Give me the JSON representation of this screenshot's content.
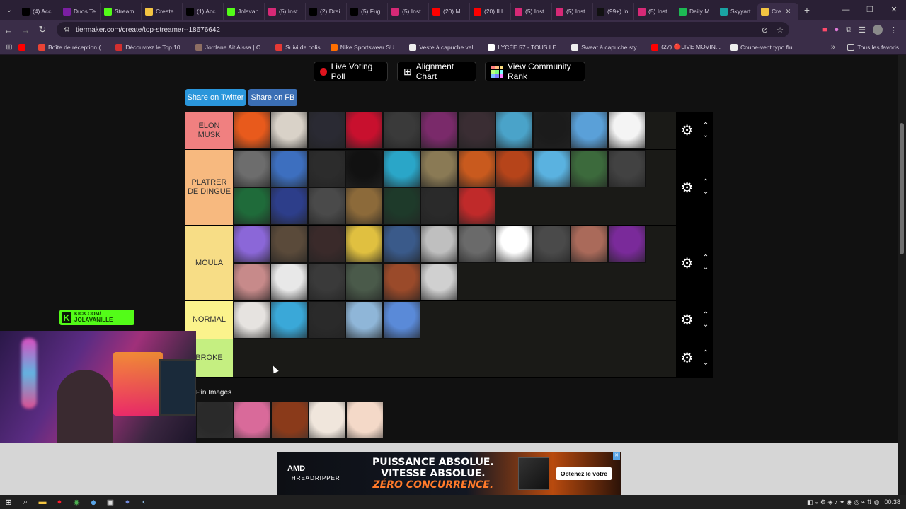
{
  "browser": {
    "tabs": [
      {
        "label": "(4) Acc",
        "icon": "x-icon",
        "color": "#000000"
      },
      {
        "label": "Duos Te",
        "icon": "doc-icon",
        "color": "#7b1fa2"
      },
      {
        "label": "Stream",
        "icon": "kick-icon",
        "color": "#53fc18"
      },
      {
        "label": "Create",
        "icon": "tiermaker-icon",
        "color": "#f4c542"
      },
      {
        "label": "(1) Acc",
        "icon": "x-icon",
        "color": "#000000"
      },
      {
        "label": "Jolavan",
        "icon": "kick-icon",
        "color": "#53fc18"
      },
      {
        "label": "(5) Inst",
        "icon": "instagram-icon",
        "color": "#d62976"
      },
      {
        "label": "(2) Drai",
        "icon": "x-icon",
        "color": "#000000"
      },
      {
        "label": "(5) Fug",
        "icon": "x-icon",
        "color": "#000000"
      },
      {
        "label": "(5) Inst",
        "icon": "instagram-icon",
        "color": "#d62976"
      },
      {
        "label": "(20) Mi",
        "icon": "youtube-icon",
        "color": "#ff0000"
      },
      {
        "label": "(20) Il l",
        "icon": "youtube-icon",
        "color": "#ff0000"
      },
      {
        "label": "(5) Inst",
        "icon": "instagram-icon",
        "color": "#d62976"
      },
      {
        "label": "(5) Inst",
        "icon": "instagram-icon",
        "color": "#d62976"
      },
      {
        "label": "(99+) In",
        "icon": "tiktok-icon",
        "color": "#111111"
      },
      {
        "label": "(5) Inst",
        "icon": "instagram-icon",
        "color": "#d62976"
      },
      {
        "label": "Daily M",
        "icon": "spotify-icon",
        "color": "#1db954"
      },
      {
        "label": "Skyyart",
        "icon": "tt-icon",
        "color": "#1aa3a3"
      },
      {
        "label": "Cre",
        "icon": "tiermaker-icon",
        "color": "#f4c542",
        "active": true
      }
    ],
    "url": "tiermaker.com/create/top-streamer--18676642",
    "bookmarks": [
      {
        "label": "",
        "color": "#ff0000"
      },
      {
        "label": "Boîte de réception (...",
        "color": "#ea4335"
      },
      {
        "label": "Découvrez le Top 10...",
        "color": "#d32f2f"
      },
      {
        "label": "Jordane Ait Aissa | C...",
        "color": "#8d6e63"
      },
      {
        "label": "Suivi de colis",
        "color": "#e53935"
      },
      {
        "label": "Nike Sportswear SU...",
        "color": "#ff6f00"
      },
      {
        "label": "Veste à capuche vel...",
        "color": "#eeeeee"
      },
      {
        "label": "LYCÉE 57 - TOUS LE...",
        "color": "#ffffff"
      },
      {
        "label": "Sweat à capuche sty...",
        "color": "#eeeeee"
      },
      {
        "label": "(27) 🔴LIVE MOVIN...",
        "color": "#ff0000"
      },
      {
        "label": "Coupe-vent typo flu...",
        "color": "#eeeeee"
      }
    ],
    "all_bookmarks": "Tous les favoris"
  },
  "page": {
    "buttons": {
      "live_voting": "Live Voting Poll",
      "alignment": "Alignment Chart",
      "community": "View Community Rank",
      "share_twitter": "Share on Twitter",
      "share_fb": "Share on FB"
    },
    "tiers": [
      {
        "label": "ELON MUSK",
        "color": "#f08080",
        "items": [
          "#e85a1c",
          "#d9d2c8",
          "#2a2a33",
          "#c8102e",
          "#3a3a3a",
          "#7a2a6a",
          "#3a2d33",
          "#4aa3c9",
          "#1b1b1b",
          "#5aa0d8",
          "#f4f4f4"
        ]
      },
      {
        "label": "PLATRER DE DINGUE",
        "color": "#f7b97f",
        "items": [
          "#6d6d6d",
          "#3d6fbf",
          "#2c2c2c",
          "#111111",
          "#2aa6c8",
          "#8a7a55",
          "#c95a1e",
          "#b6441a",
          "#5ab2e0",
          "#3c6a3c",
          "#424242",
          "#1f6b3a",
          "#2d3e8a",
          "#4a4a4a",
          "#8c6a3a",
          "#1e3a2a",
          "#2a2a2a",
          "#c02a2a"
        ]
      },
      {
        "label": "MOULA",
        "color": "#f7dd86",
        "items": [
          "#8b67d8",
          "#5a4a3a",
          "#3a2a2a",
          "#e0c040",
          "#3a5a8a",
          "#bfbfbf",
          "#6a6a6a",
          "#ffffff",
          "#4a4a4a",
          "#aa6a5a",
          "#7a2a9a",
          "#c78a8a",
          "#e8e8e8",
          "#3a3a3a",
          "#4a5a4a",
          "#9a4a2a",
          "#d0d0d0"
        ]
      },
      {
        "label": "NORMAL",
        "color": "#fbf38c",
        "items": [
          "#e6e3e0",
          "#3aa8d8",
          "#2a2a2a",
          "#8fb6d8",
          "#5a8ad8"
        ]
      },
      {
        "label": "BROKE",
        "color": "#c5ef81",
        "items": []
      }
    ],
    "pin_title": "Pin Images",
    "pin_items": [
      "#2a2a2a",
      "#d96a9a",
      "#8a3a1a",
      "#f0e6dc",
      "#f4d9c8"
    ]
  },
  "overlay": {
    "kick_line1": "KICK.COM/",
    "kick_line2": "JOLAVANILLE"
  },
  "ad": {
    "brand": "AMD",
    "product": "THREADRIPPER",
    "line1": "PUISSANCE ABSOLUE.",
    "line2": "VITESSE ABSOLUE.",
    "line3": "ZÉRO CONCURRENCE.",
    "cta": "Obtenez le vôtre"
  },
  "taskbar": {
    "time": "00:38"
  }
}
